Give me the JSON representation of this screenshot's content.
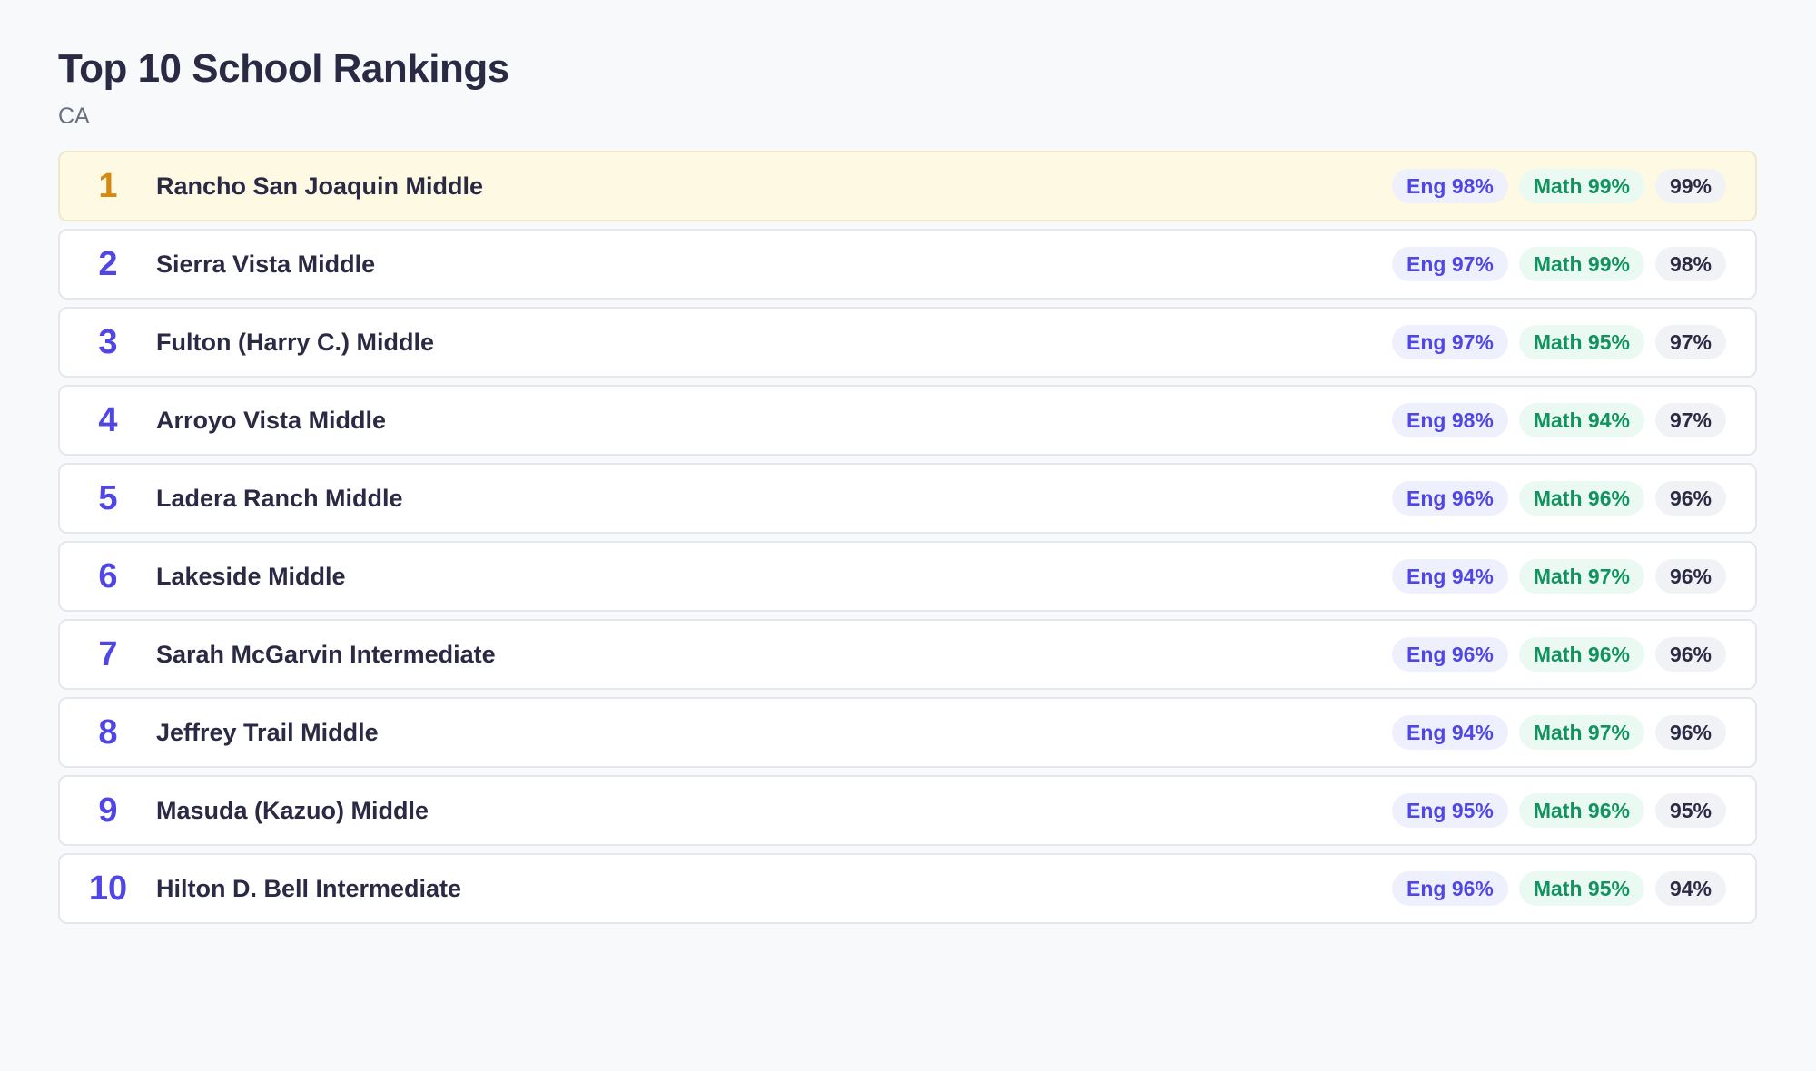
{
  "header": {
    "title": "Top 10 School Rankings",
    "subtitle": "CA"
  },
  "rankings": [
    {
      "rank": "1",
      "school": "Rancho San Joaquin Middle",
      "eng": "Eng 98%",
      "math": "Math 99%",
      "overall": "99%"
    },
    {
      "rank": "2",
      "school": "Sierra Vista Middle",
      "eng": "Eng 97%",
      "math": "Math 99%",
      "overall": "98%"
    },
    {
      "rank": "3",
      "school": "Fulton (Harry C.) Middle",
      "eng": "Eng 97%",
      "math": "Math 95%",
      "overall": "97%"
    },
    {
      "rank": "4",
      "school": "Arroyo Vista Middle",
      "eng": "Eng 98%",
      "math": "Math 94%",
      "overall": "97%"
    },
    {
      "rank": "5",
      "school": "Ladera Ranch Middle",
      "eng": "Eng 96%",
      "math": "Math 96%",
      "overall": "96%"
    },
    {
      "rank": "6",
      "school": "Lakeside Middle",
      "eng": "Eng 94%",
      "math": "Math 97%",
      "overall": "96%"
    },
    {
      "rank": "7",
      "school": "Sarah McGarvin Intermediate",
      "eng": "Eng 96%",
      "math": "Math 96%",
      "overall": "96%"
    },
    {
      "rank": "8",
      "school": "Jeffrey Trail Middle",
      "eng": "Eng 94%",
      "math": "Math 97%",
      "overall": "96%"
    },
    {
      "rank": "9",
      "school": "Masuda (Kazuo) Middle",
      "eng": "Eng 95%",
      "math": "Math 96%",
      "overall": "95%"
    },
    {
      "rank": "10",
      "school": "Hilton D. Bell Intermediate",
      "eng": "Eng 96%",
      "math": "Math 95%",
      "overall": "94%"
    }
  ],
  "colors": {
    "rank_default": "#4f46e5",
    "rank_first": "#d48a0f",
    "first_row_background": "#fef9e3",
    "eng_pill_text": "#4f46e5",
    "math_pill_text": "#12925f"
  }
}
